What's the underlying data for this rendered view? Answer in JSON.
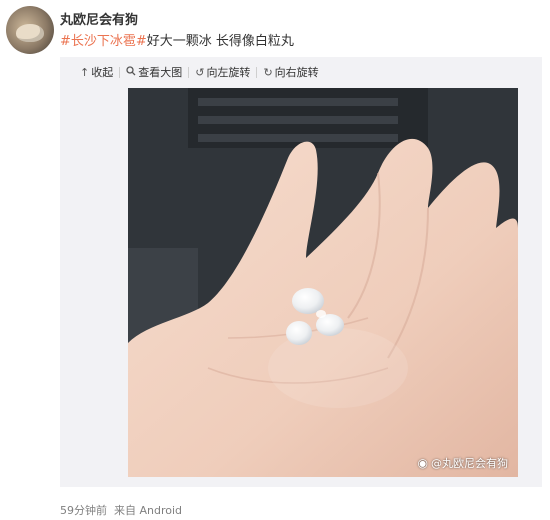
{
  "user": {
    "name": "丸欧尼会有狗"
  },
  "post": {
    "hashtag": "#长沙下冰雹#",
    "text": "好大一颗冰 长得像白粒丸"
  },
  "toolbar": {
    "collapse": {
      "icon": "arrow-up-icon",
      "label": "收起"
    },
    "view_large": {
      "icon": "search-icon",
      "label": "查看大图"
    },
    "rotate_left": {
      "icon": "rotate-left-icon",
      "label": "向左旋转"
    },
    "rotate_right": {
      "icon": "rotate-right-icon",
      "label": "向右旋转"
    }
  },
  "photo": {
    "watermark": "@丸欧尼会有狗"
  },
  "meta": {
    "time": "59分钟前",
    "source": "来自 Android"
  },
  "colors": {
    "hashtag": "#eb7350",
    "media_bg": "#f2f2f5",
    "meta_text": "#808080"
  }
}
